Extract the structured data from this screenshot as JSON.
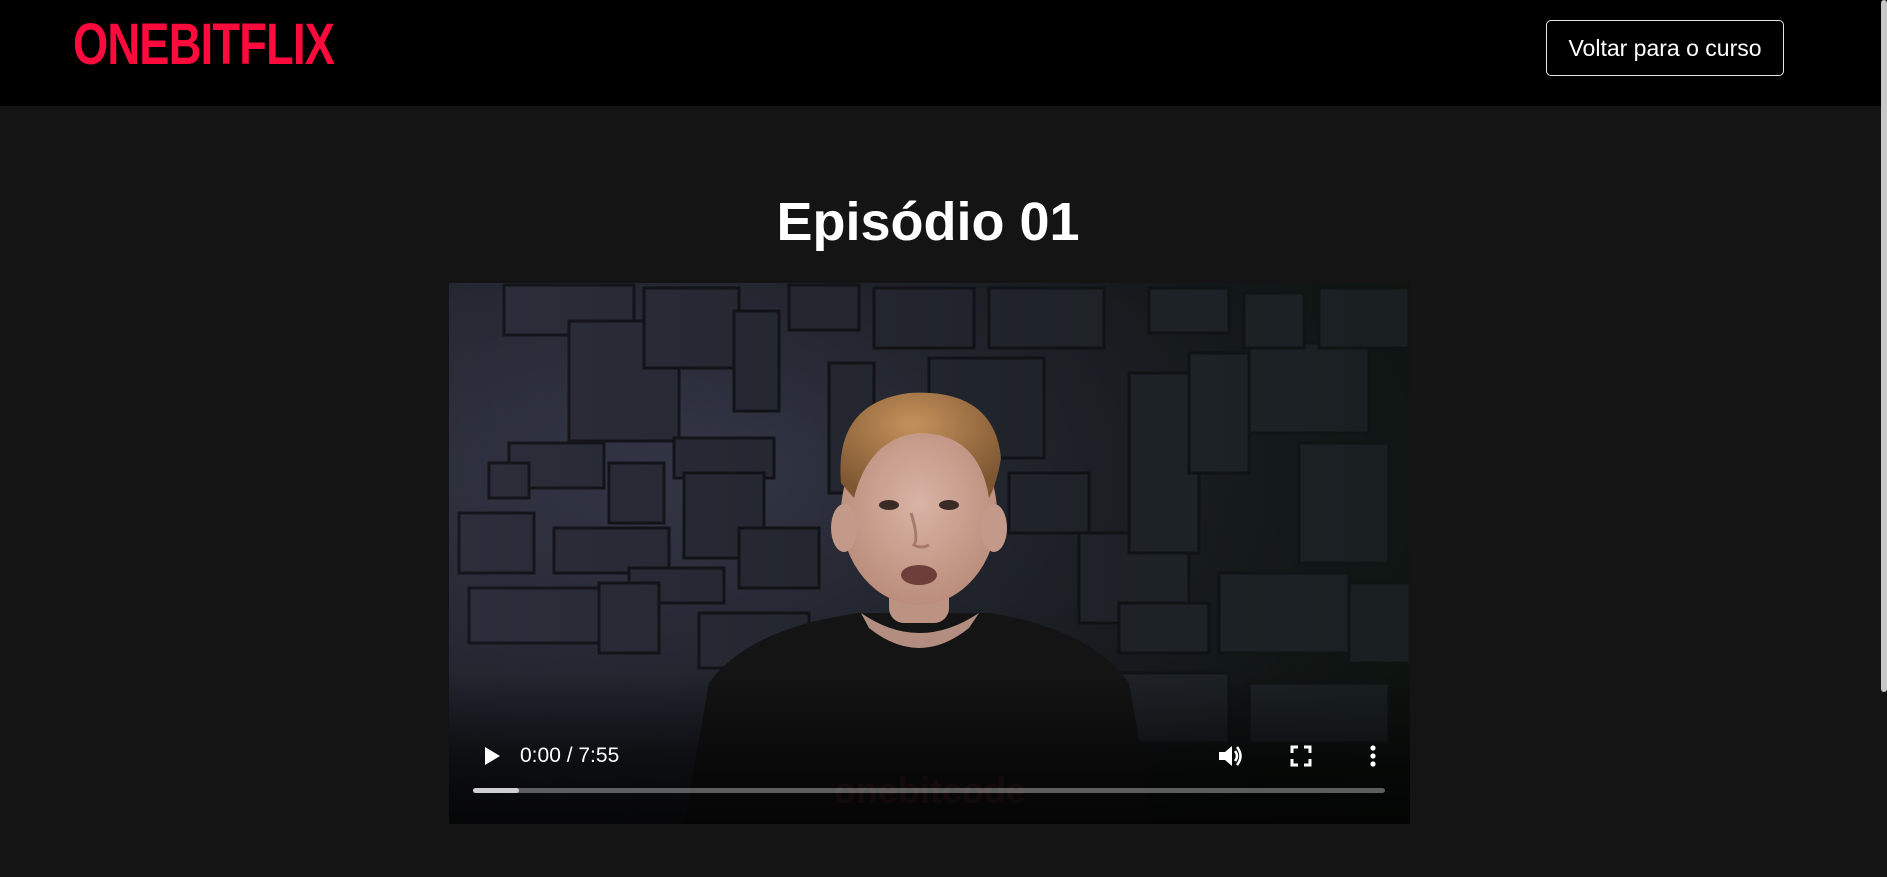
{
  "header": {
    "logo_text": "ONEBITFLIX",
    "back_button_label": "Voltar para o curso",
    "brand_color": "#ff0a3c"
  },
  "episode": {
    "title": "Episódio 01"
  },
  "player": {
    "current_time": "0:00",
    "duration": "7:55",
    "time_label": "0:00 / 7:55",
    "buffered_fraction": 0.05,
    "icons": {
      "play": "play-icon",
      "volume": "volume-icon",
      "fullscreen": "fullscreen-icon",
      "more": "more-options-icon"
    }
  }
}
